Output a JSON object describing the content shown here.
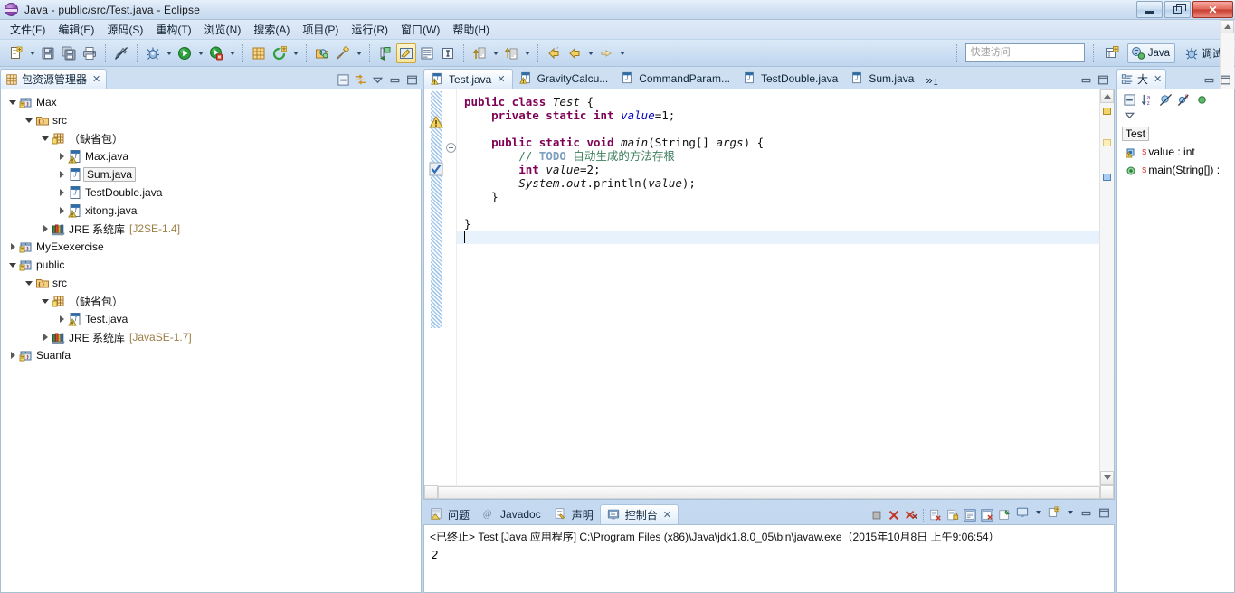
{
  "window": {
    "title": "Java - public/src/Test.java - Eclipse",
    "app_icon": "eclipse-icon",
    "controls": {
      "minimize": "minimize-button",
      "restore": "restore-button",
      "close": "close-button"
    }
  },
  "menubar": {
    "items": [
      {
        "label": "文件(F)",
        "name": "menu-file"
      },
      {
        "label": "编辑(E)",
        "name": "menu-edit"
      },
      {
        "label": "源码(S)",
        "name": "menu-source"
      },
      {
        "label": "重构(T)",
        "name": "menu-refactor"
      },
      {
        "label": "浏览(N)",
        "name": "menu-navigate"
      },
      {
        "label": "搜索(A)",
        "name": "menu-search"
      },
      {
        "label": "项目(P)",
        "name": "menu-project"
      },
      {
        "label": "运行(R)",
        "name": "menu-run"
      },
      {
        "label": "窗口(W)",
        "name": "menu-window"
      },
      {
        "label": "帮助(H)",
        "name": "menu-help"
      }
    ]
  },
  "toolbar": {
    "quick_access_placeholder": "快速访问",
    "perspective_java": "Java",
    "perspective_debug": "调试",
    "buttons": [
      "new-wizard-icon",
      "save-icon",
      "save-all-icon",
      "print-icon",
      "toggle-markoccurrences-icon",
      "debug-icon",
      "run-icon",
      "run-coverage-icon",
      "new-java-project-icon",
      "new-class-icon",
      "open-type-icon",
      "search-icon",
      "last-edit-location-icon",
      "toggle-java-editor-icon",
      "toggle-breadcrumb-icon",
      "toggle-block-selection-icon",
      "next-annotation-icon",
      "previous-annotation-icon",
      "back-icon",
      "forward-icon",
      "next-icon"
    ]
  },
  "package_explorer": {
    "title": "包资源管理器",
    "close_glyph": "✕",
    "toolbar": [
      "collapse-all-icon",
      "link-with-editor-icon",
      "view-menu-icon",
      "minimize-icon",
      "maximize-icon"
    ],
    "tree": [
      {
        "label": "Max",
        "indent": 0,
        "twist": "expanded",
        "icon": "java-project-icon",
        "selected": false
      },
      {
        "label": "src",
        "indent": 1,
        "twist": "expanded",
        "icon": "source-folder-icon",
        "selected": false
      },
      {
        "label": "（缺省包）",
        "indent": 2,
        "twist": "expanded",
        "icon": "package-icon",
        "selected": false
      },
      {
        "label": "Max.java",
        "indent": 3,
        "twist": "collapsed",
        "icon": "java-file-warning-icon",
        "selected": false
      },
      {
        "label": "Sum.java",
        "indent": 3,
        "twist": "collapsed",
        "icon": "java-file-icon",
        "selected": true
      },
      {
        "label": "TestDouble.java",
        "indent": 3,
        "twist": "collapsed",
        "icon": "java-file-icon",
        "selected": false
      },
      {
        "label": "xitong.java",
        "indent": 3,
        "twist": "collapsed",
        "icon": "java-file-warning-icon",
        "selected": false
      },
      {
        "label": "JRE 系统库",
        "suffix": "[J2SE-1.4]",
        "indent": 2,
        "twist": "collapsed",
        "icon": "jre-library-icon",
        "selected": false
      },
      {
        "label": "MyExexercise",
        "indent": 0,
        "twist": "collapsed",
        "icon": "java-project-icon",
        "selected": false
      },
      {
        "label": "public",
        "indent": 0,
        "twist": "expanded",
        "icon": "java-project-icon",
        "selected": false
      },
      {
        "label": "src",
        "indent": 1,
        "twist": "expanded",
        "icon": "source-folder-icon",
        "selected": false
      },
      {
        "label": "（缺省包）",
        "indent": 2,
        "twist": "expanded",
        "icon": "package-icon",
        "selected": false
      },
      {
        "label": "Test.java",
        "indent": 3,
        "twist": "collapsed",
        "icon": "java-file-warning-icon",
        "selected": false
      },
      {
        "label": "JRE 系统库",
        "suffix": "[JavaSE-1.7]",
        "indent": 2,
        "twist": "collapsed",
        "icon": "jre-library-icon",
        "selected": false
      },
      {
        "label": "Suanfa",
        "indent": 0,
        "twist": "collapsed",
        "icon": "java-project-icon",
        "selected": false
      }
    ]
  },
  "editor": {
    "tabs": [
      {
        "label": "Test.java",
        "active": true,
        "icon": "java-file-warning-icon",
        "close_glyph": "✕"
      },
      {
        "label": "GravityCalcu...",
        "active": false,
        "icon": "java-file-warning-icon"
      },
      {
        "label": "CommandParam...",
        "active": false,
        "icon": "java-file-icon"
      },
      {
        "label": "TestDouble.java",
        "active": false,
        "icon": "java-file-icon"
      },
      {
        "label": "Sum.java",
        "active": false,
        "icon": "java-file-icon"
      }
    ],
    "overflow_chevron": "»",
    "overflow_count": "1",
    "minimize_glyph": "minimize-icon",
    "maximize_glyph": "maximize-icon",
    "code_lines": [
      {
        "segments": [
          {
            "t": "public class ",
            "c": "kw"
          },
          {
            "t": "Test",
            "c": "it"
          },
          {
            "t": " {",
            "c": ""
          }
        ]
      },
      {
        "segments": [
          {
            "t": "    private static int ",
            "c": "kw"
          },
          {
            "t": "value",
            "c": "fld"
          },
          {
            "t": "=1;",
            "c": ""
          }
        ]
      },
      {
        "segments": [
          {
            "t": "",
            "c": ""
          }
        ]
      },
      {
        "segments": [
          {
            "t": "    public static void ",
            "c": "kw"
          },
          {
            "t": "main",
            "c": "it"
          },
          {
            "t": "(String[] ",
            "c": ""
          },
          {
            "t": "args",
            "c": "it"
          },
          {
            "t": ") {",
            "c": ""
          }
        ]
      },
      {
        "segments": [
          {
            "t": "        // ",
            "c": "cmt"
          },
          {
            "t": "TODO",
            "c": "cmt-task"
          },
          {
            "t": " 自动生成的方法存根",
            "c": "cmt"
          }
        ]
      },
      {
        "segments": [
          {
            "t": "        int ",
            "c": "kw"
          },
          {
            "t": "value",
            "c": "it"
          },
          {
            "t": "=2;",
            "c": ""
          }
        ]
      },
      {
        "segments": [
          {
            "t": "        ",
            "c": ""
          },
          {
            "t": "System",
            "c": "it"
          },
          {
            "t": ".",
            "c": ""
          },
          {
            "t": "out",
            "c": "it"
          },
          {
            "t": ".println(",
            "c": ""
          },
          {
            "t": "value",
            "c": "it"
          },
          {
            "t": ");",
            "c": ""
          }
        ]
      },
      {
        "segments": [
          {
            "t": "    }",
            "c": ""
          }
        ]
      },
      {
        "segments": [
          {
            "t": "",
            "c": ""
          }
        ]
      },
      {
        "segments": [
          {
            "t": "}",
            "c": ""
          }
        ]
      }
    ],
    "caret_line_index": 10
  },
  "outline": {
    "title": "大",
    "close_glyph": "✕",
    "toolbar": [
      "collapse-all-icon",
      "sort-icon",
      "hide-fields-icon",
      "hide-static-icon",
      "hide-nonpublic-icon",
      "view-menu-icon"
    ],
    "items": [
      {
        "label": "Test",
        "icon": "class-icon",
        "selected": true,
        "indent": 0
      },
      {
        "label": "value : int",
        "name_part": "value",
        "type_part": "int",
        "icon": "field-static-warning-icon",
        "modifier": "S",
        "selected": false,
        "indent": 1
      },
      {
        "label": "main(String[]) :",
        "icon": "method-public-icon",
        "modifier": "S",
        "selected": false,
        "indent": 1
      }
    ]
  },
  "console": {
    "tabs": [
      {
        "label": "问题",
        "active": false,
        "icon": "problems-icon"
      },
      {
        "label": "Javadoc",
        "active": false,
        "icon": "javadoc-icon"
      },
      {
        "label": "声明",
        "active": false,
        "icon": "declaration-icon"
      },
      {
        "label": "控制台",
        "active": true,
        "icon": "console-icon",
        "close_glyph": "✕"
      }
    ],
    "toolbar": [
      "terminate-icon",
      "remove-launch-icon",
      "remove-all-terminated-icon",
      "clear-console-icon",
      "lock-scroll-icon",
      "scroll-lock-icon",
      "show-console-on-output-icon",
      "pin-console-icon",
      "display-selected-console-icon",
      "open-console-icon",
      "minimize-icon",
      "maximize-icon"
    ],
    "launch_header": "<已终止> Test [Java 应用程序] C:\\Program Files (x86)\\Java\\jdk1.8.0_05\\bin\\javaw.exe（2015年10月8日 上午9:06:54）",
    "output": "2"
  },
  "colors": {
    "accent": "#7f0055",
    "field": "#0000c0",
    "comment": "#3f7f5f",
    "task_tag": "#7f9fbf",
    "chrome": "#c6d9ef",
    "selection": "#e8f2fd"
  }
}
